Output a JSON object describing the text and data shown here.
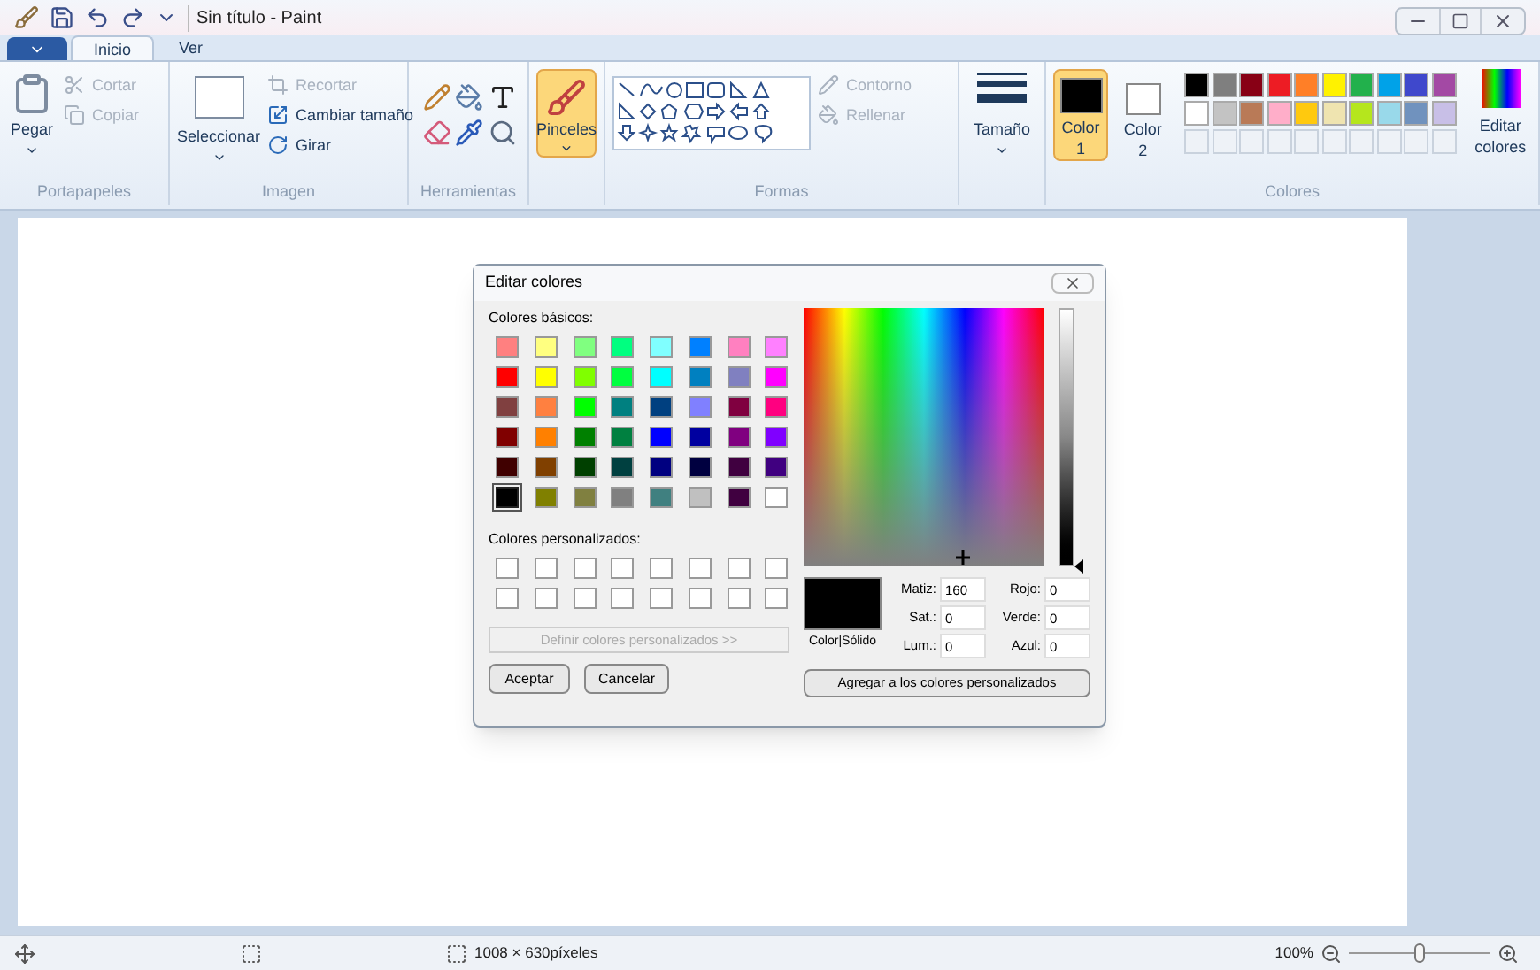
{
  "window": {
    "title": "Sin título - Paint"
  },
  "tabs": [
    {
      "label": "Inicio",
      "selected": true
    },
    {
      "label": "Ver",
      "selected": false
    }
  ],
  "ribbon": {
    "clipboard": {
      "label": "Portapapeles",
      "paste": "Pegar",
      "items": [
        {
          "label": "Cortar",
          "disabled": true
        },
        {
          "label": "Copiar",
          "disabled": true
        }
      ]
    },
    "image": {
      "label": "Imagen",
      "select": "Seleccionar",
      "items": [
        {
          "label": "Recortar",
          "disabled": true
        },
        {
          "label": "Cambiar tamaño",
          "disabled": false
        },
        {
          "label": "Girar",
          "disabled": false
        }
      ]
    },
    "tools": {
      "label": "Herramientas"
    },
    "brushes": {
      "label": "Pinceles",
      "selected": true
    },
    "shapes": {
      "label": "Formas",
      "items": [
        {
          "label": "Contorno",
          "disabled": true
        },
        {
          "label": "Rellenar",
          "disabled": true
        }
      ]
    },
    "size": {
      "label": "Tamaño"
    },
    "colors": {
      "label": "Colores",
      "slots": [
        {
          "label": "Color",
          "number": "1",
          "color": "#000000",
          "selected": true
        },
        {
          "label": "Color",
          "number": "2",
          "color": "#ffffff",
          "selected": false
        }
      ],
      "palette": [
        {
          "kind": "color",
          "color": "#000000"
        },
        {
          "kind": "color",
          "color": "#7f7f7f"
        },
        {
          "kind": "color",
          "color": "#880015"
        },
        {
          "kind": "color",
          "color": "#ed1c24"
        },
        {
          "kind": "color",
          "color": "#ff7f27"
        },
        {
          "kind": "color",
          "color": "#fff200"
        },
        {
          "kind": "color",
          "color": "#22b14c"
        },
        {
          "kind": "color",
          "color": "#00a2e8"
        },
        {
          "kind": "color",
          "color": "#3f48cc"
        },
        {
          "kind": "color",
          "color": "#a349a4"
        },
        {
          "kind": "color",
          "color": "#ffffff"
        },
        {
          "kind": "color",
          "color": "#c3c3c3"
        },
        {
          "kind": "color",
          "color": "#b97a57"
        },
        {
          "kind": "color",
          "color": "#ffaec9"
        },
        {
          "kind": "color",
          "color": "#ffc90e"
        },
        {
          "kind": "color",
          "color": "#efe4b0"
        },
        {
          "kind": "color",
          "color": "#b5e61d"
        },
        {
          "kind": "color",
          "color": "#99d9ea"
        },
        {
          "kind": "color",
          "color": "#7092be"
        },
        {
          "kind": "color",
          "color": "#c8bfe7"
        },
        {
          "kind": "empty"
        },
        {
          "kind": "empty"
        },
        {
          "kind": "empty"
        },
        {
          "kind": "empty"
        },
        {
          "kind": "empty"
        },
        {
          "kind": "empty"
        },
        {
          "kind": "empty"
        },
        {
          "kind": "empty"
        },
        {
          "kind": "empty"
        },
        {
          "kind": "empty"
        }
      ],
      "edit": "Editar colores"
    }
  },
  "dialog": {
    "title": "Editar colores",
    "basic_label": "Colores básicos:",
    "basic_colors": [
      {
        "color": "#ff8080",
        "selected": false
      },
      {
        "color": "#ffff80",
        "selected": false
      },
      {
        "color": "#80ff80",
        "selected": false
      },
      {
        "color": "#00ff80",
        "selected": false
      },
      {
        "color": "#80ffff",
        "selected": false
      },
      {
        "color": "#0080ff",
        "selected": false
      },
      {
        "color": "#ff80c0",
        "selected": false
      },
      {
        "color": "#ff80ff",
        "selected": false
      },
      {
        "color": "#ff0000",
        "selected": false
      },
      {
        "color": "#ffff00",
        "selected": false
      },
      {
        "color": "#80ff00",
        "selected": false
      },
      {
        "color": "#00ff40",
        "selected": false
      },
      {
        "color": "#00ffff",
        "selected": false
      },
      {
        "color": "#0080c0",
        "selected": false
      },
      {
        "color": "#8080c0",
        "selected": false
      },
      {
        "color": "#ff00ff",
        "selected": false
      },
      {
        "color": "#804040",
        "selected": false
      },
      {
        "color": "#ff8040",
        "selected": false
      },
      {
        "color": "#00ff00",
        "selected": false
      },
      {
        "color": "#008080",
        "selected": false
      },
      {
        "color": "#004080",
        "selected": false
      },
      {
        "color": "#8080ff",
        "selected": false
      },
      {
        "color": "#800040",
        "selected": false
      },
      {
        "color": "#ff0080",
        "selected": false
      },
      {
        "color": "#800000",
        "selected": false
      },
      {
        "color": "#ff8000",
        "selected": false
      },
      {
        "color": "#008000",
        "selected": false
      },
      {
        "color": "#008040",
        "selected": false
      },
      {
        "color": "#0000ff",
        "selected": false
      },
      {
        "color": "#0000a0",
        "selected": false
      },
      {
        "color": "#800080",
        "selected": false
      },
      {
        "color": "#8000ff",
        "selected": false
      },
      {
        "color": "#400000",
        "selected": false
      },
      {
        "color": "#804000",
        "selected": false
      },
      {
        "color": "#004000",
        "selected": false
      },
      {
        "color": "#004040",
        "selected": false
      },
      {
        "color": "#000080",
        "selected": false
      },
      {
        "color": "#000040",
        "selected": false
      },
      {
        "color": "#400040",
        "selected": false
      },
      {
        "color": "#400080",
        "selected": false
      },
      {
        "color": "#000000",
        "selected": true
      },
      {
        "color": "#808000",
        "selected": false
      },
      {
        "color": "#808040",
        "selected": false
      },
      {
        "color": "#808080",
        "selected": false
      },
      {
        "color": "#408080",
        "selected": false
      },
      {
        "color": "#c0c0c0",
        "selected": false
      },
      {
        "color": "#400040",
        "selected": false
      },
      {
        "color": "#ffffff",
        "selected": false
      }
    ],
    "custom_label": "Colores personalizados:",
    "custom_colors": [
      {
        "kind": "empty"
      },
      {
        "kind": "empty"
      },
      {
        "kind": "empty"
      },
      {
        "kind": "empty"
      },
      {
        "kind": "empty"
      },
      {
        "kind": "empty"
      },
      {
        "kind": "empty"
      },
      {
        "kind": "empty"
      },
      {
        "kind": "empty"
      },
      {
        "kind": "empty"
      },
      {
        "kind": "empty"
      },
      {
        "kind": "empty"
      },
      {
        "kind": "empty"
      },
      {
        "kind": "empty"
      },
      {
        "kind": "empty"
      },
      {
        "kind": "empty"
      }
    ],
    "define_button": {
      "label": "Definir colores personalizados >>",
      "disabled": true
    },
    "ok_button": "Aceptar",
    "cancel_button": "Cancelar",
    "luminosity": {
      "level": 0
    },
    "solid_color": {
      "label": "Color|Sólido",
      "color": "#000000"
    },
    "fields_left": [
      {
        "label": "Matiz:",
        "value": "160"
      },
      {
        "label": "Sat.:",
        "value": "0"
      },
      {
        "label": "Lum.:",
        "value": "0"
      }
    ],
    "fields_right": [
      {
        "label": "Rojo:",
        "value": "0"
      },
      {
        "label": "Verde:",
        "value": "0"
      },
      {
        "label": "Azul:",
        "value": "0"
      }
    ],
    "add_button": "Agregar a los colores personalizados"
  },
  "status_bar": {
    "size": "1008 × 630píxeles",
    "zoom": "100%",
    "zoom_slider": {
      "level": 0.5
    }
  }
}
